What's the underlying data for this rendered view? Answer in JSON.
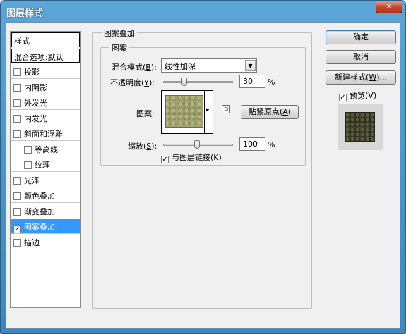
{
  "window": {
    "title": "图层样式",
    "close_glyph": "✕"
  },
  "style_list": {
    "header": "样式",
    "blend_options": "混合选项:默认",
    "items": [
      {
        "label": "投影",
        "checked": false
      },
      {
        "label": "内阴影",
        "checked": false
      },
      {
        "label": "外发光",
        "checked": false
      },
      {
        "label": "内发光",
        "checked": false
      },
      {
        "label": "斜面和浮雕",
        "checked": false
      },
      {
        "label": "等高线",
        "checked": false
      },
      {
        "label": "纹理",
        "checked": false
      },
      {
        "label": "光泽",
        "checked": false
      },
      {
        "label": "颜色叠加",
        "checked": false
      },
      {
        "label": "渐变叠加",
        "checked": false
      },
      {
        "label": "图案叠加",
        "checked": true
      },
      {
        "label": "描边",
        "checked": false
      }
    ]
  },
  "pattern_overlay": {
    "group_title": "图案叠加",
    "subgroup_title": "图案",
    "blend_mode_label": "混合模式(",
    "blend_mode_key": "B",
    "blend_mode_tail": "):",
    "blend_mode_value": "线性加深",
    "opacity_label": "不透明度(",
    "opacity_key": "Y",
    "opacity_tail": "):",
    "opacity_value": "30",
    "opacity_unit": "%",
    "pattern_label": "图案:",
    "snap_origin_label": "贴紧原点(",
    "snap_origin_key": "A",
    "snap_origin_tail": ")",
    "scale_label": "缩放(",
    "scale_key": "S",
    "scale_tail": "):",
    "scale_value": "100",
    "scale_unit": "%",
    "link_label": "与图层链接(",
    "link_key": "K",
    "link_tail": ")",
    "link_checked": true
  },
  "buttons": {
    "ok": "确定",
    "cancel": "取消",
    "new_style": "新建样式(",
    "new_style_key": "W",
    "new_style_tail": ")...",
    "preview_label": "预览(",
    "preview_key": "V",
    "preview_tail": ")",
    "preview_checked": true
  },
  "icons": {
    "check": "✓",
    "dropdown_arrow": "▼",
    "pattern_arrow": "▸",
    "new_preset": "▫"
  }
}
